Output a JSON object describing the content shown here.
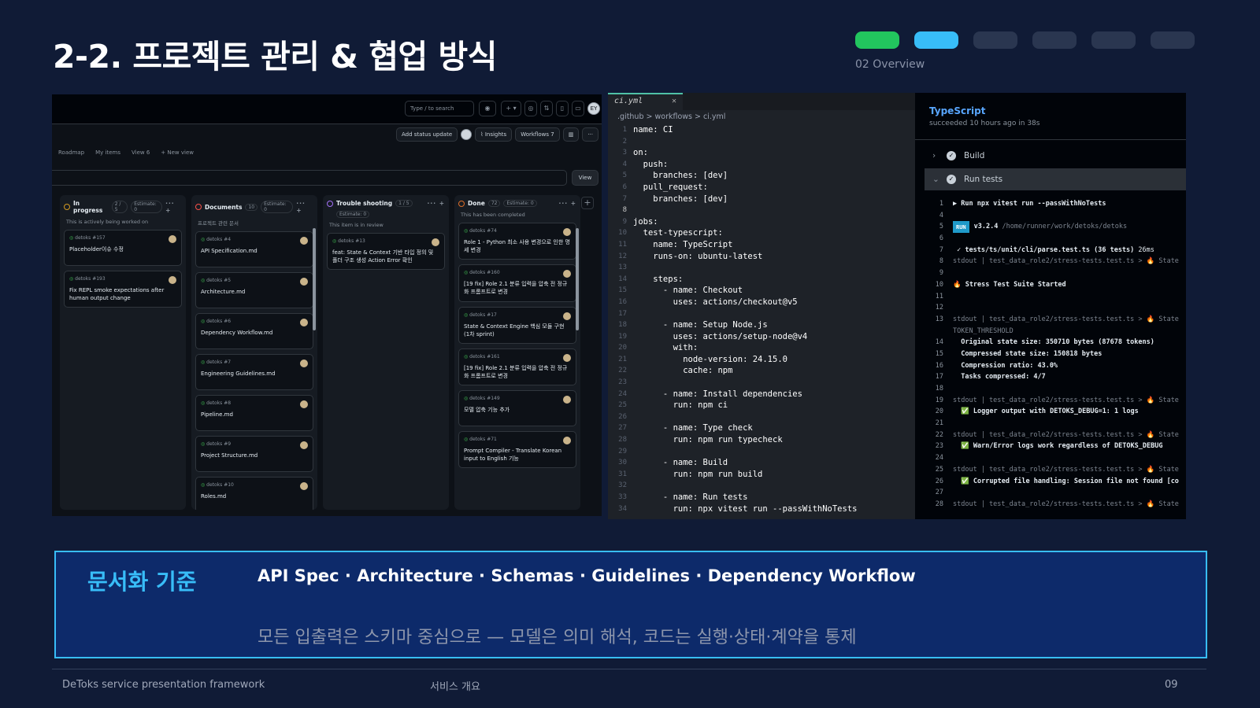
{
  "slide": {
    "title": "2-2. 프로젝트 관리 & 협업 방식",
    "section": "02 Overview",
    "progress_colors": [
      "#22c55e",
      "#38bdf8",
      "#2a3650",
      "#2a3650",
      "#2a3650",
      "#2a3650"
    ]
  },
  "board": {
    "search_placeholder": "Type / to search",
    "add_status_update": "Add status update",
    "insights": "Insights",
    "workflows": "Workflows",
    "workflows_count": "7",
    "views": [
      "Roadmap",
      "My items",
      "View 6",
      "+ New view"
    ],
    "view_button": "View",
    "avatar_initials": "EY",
    "columns": [
      {
        "name": "In progress",
        "count": "2 / 5",
        "estimate": "Estimate: 0",
        "color": "#d29922",
        "desc": "This is actively being worked on",
        "cards": [
          {
            "ref": "detoks #157",
            "title": "Placeholder이슈 수정"
          },
          {
            "ref": "detoks #193",
            "title": "Fix REPL smoke expectations after human output change"
          }
        ]
      },
      {
        "name": "Documents",
        "count": "10",
        "estimate": "Estimate: 0",
        "color": "#f85149",
        "desc": "프로젝트 관련 문서",
        "cards": [
          {
            "ref": "detoks #4",
            "title": "API Specification.md"
          },
          {
            "ref": "detoks #5",
            "title": "Architecture.md"
          },
          {
            "ref": "detoks #6",
            "title": "Dependency Workflow.md"
          },
          {
            "ref": "detoks #7",
            "title": "Engineering Guidelines.md"
          },
          {
            "ref": "detoks #8",
            "title": "Pipeline.md"
          },
          {
            "ref": "detoks #9",
            "title": "Project Structure.md"
          },
          {
            "ref": "detoks #10",
            "title": "Roles.md"
          }
        ]
      },
      {
        "name": "Trouble shooting",
        "count": "1 / 5",
        "estimate": "Estimate: 0",
        "color": "#a371f7",
        "desc": "This item is in review",
        "cards": [
          {
            "ref": "detoks #13",
            "title": "feat: State & Context 기반 타입 정의 및 폴더 구조 생성 Action Error 확인"
          }
        ]
      },
      {
        "name": "Done",
        "count": "72",
        "estimate": "Estimate: 0",
        "color": "#db6d28",
        "desc": "This has been completed",
        "cards": [
          {
            "ref": "detoks #74",
            "title": "Role 1 - Python 최소 사용 변경으로 인한 명세 변경"
          },
          {
            "ref": "detoks #160",
            "title": "[19 fix] Role 2.1 분류 입력을 압축 전 정규화 프롬프트로 변경"
          },
          {
            "ref": "detoks #17",
            "title": "State & Context Engine 핵심 모듈 구현 (1차 sprint)"
          },
          {
            "ref": "detoks #161",
            "title": "[19 fix] Role 2.1 분류 입력을 압축 전 정규화 프롬프트로 변경"
          },
          {
            "ref": "detoks #149",
            "title": "모델 압축 기능 추가"
          },
          {
            "ref": "detoks #71",
            "title": "Prompt Compiler - Translate Korean input to English 기능"
          }
        ]
      }
    ]
  },
  "editor": {
    "tab": "ci.yml",
    "breadcrumb": ".github > workflows > ci.yml",
    "lines": [
      "name: CI",
      "",
      "on:",
      "  push:",
      "    branches: [dev]",
      "  pull_request:",
      "    branches: [dev]",
      "",
      "jobs:",
      "  test-typescript:",
      "    name: TypeScript",
      "    runs-on: ubuntu-latest",
      "",
      "    steps:",
      "      - name: Checkout",
      "        uses: actions/checkout@v5",
      "",
      "      - name: Setup Node.js",
      "        uses: actions/setup-node@v4",
      "        with:",
      "          node-version: 24.15.0",
      "          cache: npm",
      "",
      "      - name: Install dependencies",
      "        run: npm ci",
      "",
      "      - name: Type check",
      "        run: npm run typecheck",
      "",
      "      - name: Build",
      "        run: npm run build",
      "",
      "      - name: Run tests",
      "        run: npx vitest run --passWithNoTests"
    ]
  },
  "ci": {
    "job": "TypeScript",
    "status": "succeeded 10 hours ago in 38s",
    "steps": [
      "Build",
      "Run tests"
    ],
    "log": [
      {
        "n": "1",
        "t": "▶ Run npx vitest run --passWithNoTests"
      },
      {
        "n": "4",
        "t": ""
      },
      {
        "n": "5",
        "badge": "RUN",
        "t": "v3.2.4",
        "dim": " /home/runner/work/detoks/detoks"
      },
      {
        "n": "6",
        "t": ""
      },
      {
        "n": "7",
        "t": " ✓ tests/ts/unit/cli/parse.test.ts (36 tests)",
        "tail": " 26ms"
      },
      {
        "n": "8",
        "dimline": "stdout | test_data_role2/stress-tests.test.ts > 🔥 State"
      },
      {
        "n": "9",
        "t": ""
      },
      {
        "n": "10",
        "t": "🔥 Stress Test Suite Started"
      },
      {
        "n": "11",
        "t": ""
      },
      {
        "n": "12",
        "t": ""
      },
      {
        "n": "13",
        "dimline": "stdout | test_data_role2/stress-tests.test.ts > 🔥 State"
      },
      {
        "n": "",
        "dimline": "TOKEN_THRESHOLD"
      },
      {
        "n": "14",
        "t": "  Original state size: 350710 bytes (87678 tokens)"
      },
      {
        "n": "15",
        "t": "  Compressed state size: 150818 bytes"
      },
      {
        "n": "16",
        "t": "  Compression ratio: 43.0%"
      },
      {
        "n": "17",
        "t": "  Tasks compressed: 4/7"
      },
      {
        "n": "18",
        "t": ""
      },
      {
        "n": "19",
        "dimline": "stdout | test_data_role2/stress-tests.test.ts > 🔥 State"
      },
      {
        "n": "20",
        "t": "  ✅ Logger output with DETOKS_DEBUG=1: 1 logs"
      },
      {
        "n": "21",
        "t": ""
      },
      {
        "n": "22",
        "dimline": "stdout | test_data_role2/stress-tests.test.ts > 🔥 State"
      },
      {
        "n": "23",
        "t": "  ✅ Warn/Error logs work regardless of DETOKS_DEBUG"
      },
      {
        "n": "24",
        "t": ""
      },
      {
        "n": "25",
        "dimline": "stdout | test_data_role2/stress-tests.test.ts > 🔥 State"
      },
      {
        "n": "26",
        "t": "  ✅ Corrupted file handling: Session file not found [co"
      },
      {
        "n": "27",
        "t": ""
      },
      {
        "n": "28",
        "dimline": "stdout | test_data_role2/stress-tests.test.ts > 🔥 State"
      }
    ]
  },
  "docs": {
    "label": "문서화 기준",
    "main": "API Spec · Architecture · Schemas · Guidelines · Dependency Workflow",
    "sub": "모든 입출력은 스키마 중심으로 — 모델은 의미 해석, 코드는 실행·상태·계약을 통제"
  },
  "footer": {
    "left": "DeToks service presentation framework",
    "center": "서비스 개요",
    "page": "09"
  }
}
